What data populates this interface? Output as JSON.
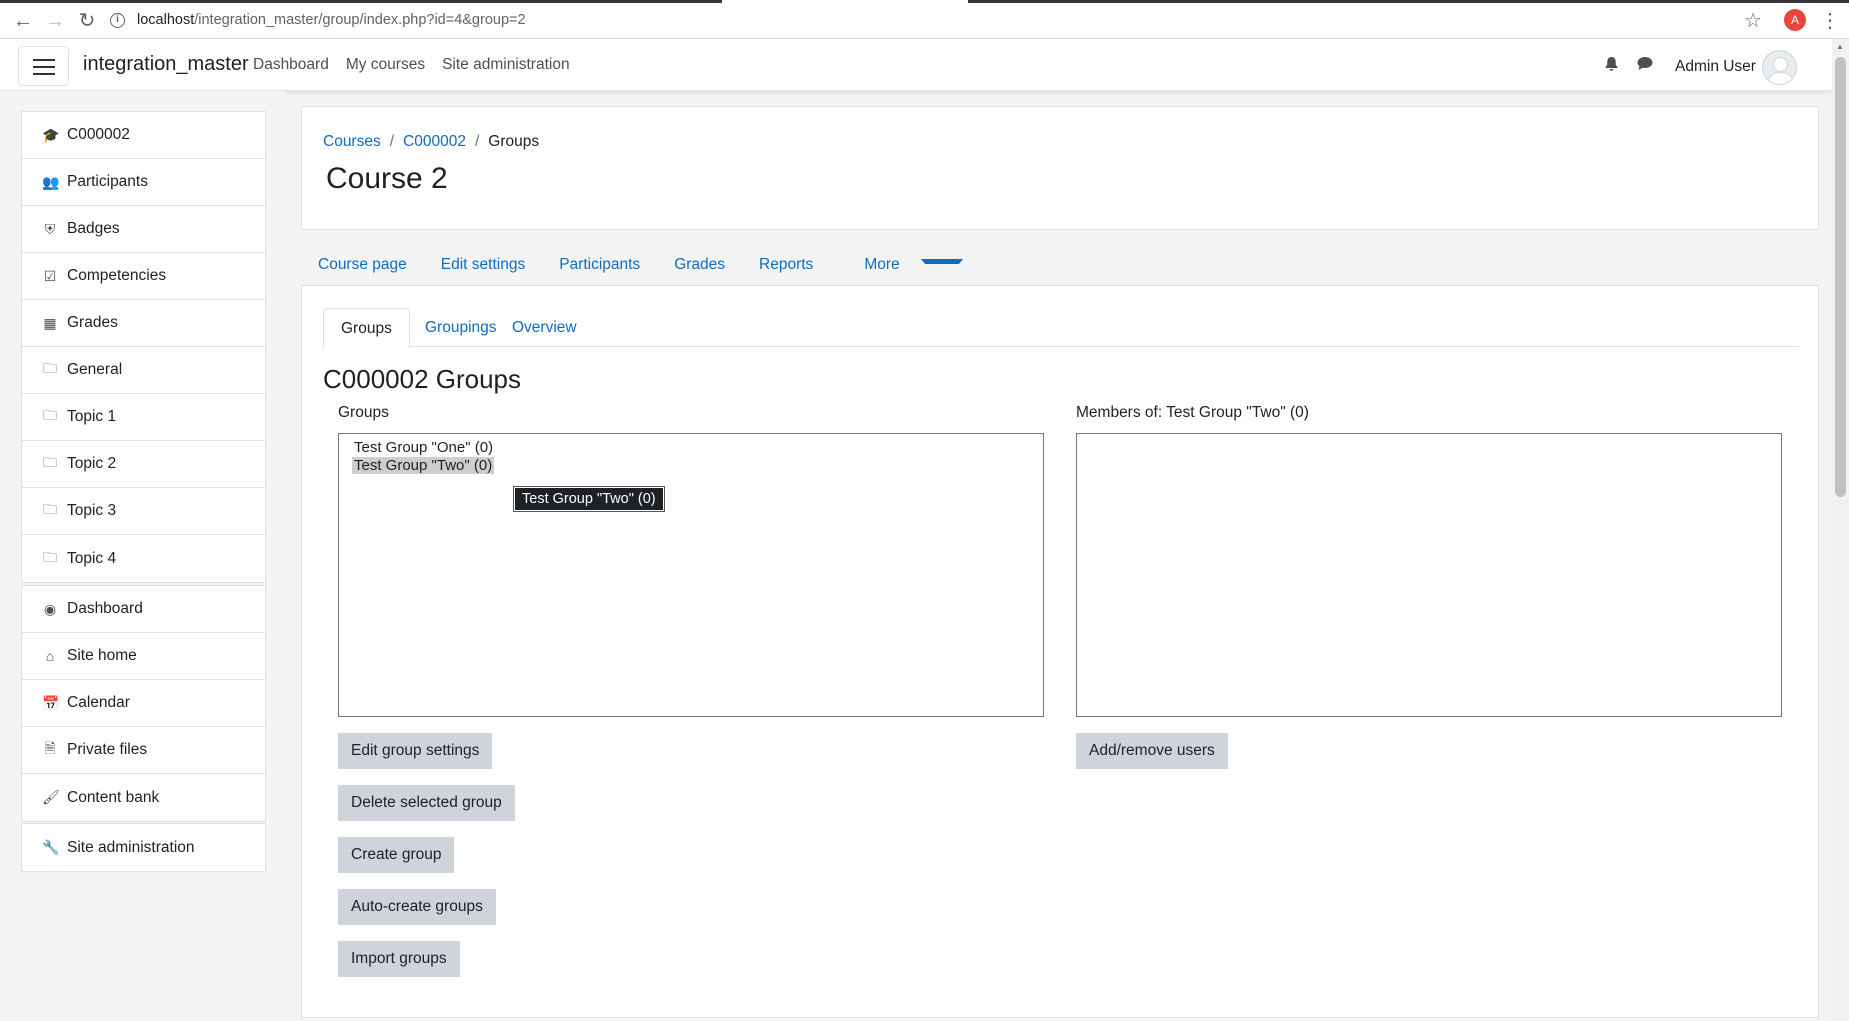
{
  "browser": {
    "url_host": "localhost",
    "url_path": "/integration_master/group/index.php?id=4&group=2",
    "profile_initial": "A"
  },
  "navbar": {
    "brand": "integration_master",
    "links": [
      "Dashboard",
      "My courses",
      "Site administration"
    ],
    "user_name": "Admin User"
  },
  "drawer": {
    "course_items": [
      {
        "label": "C000002",
        "icon": "graduation-cap-icon"
      },
      {
        "label": "Participants",
        "icon": "users-icon"
      },
      {
        "label": "Badges",
        "icon": "shield-icon"
      },
      {
        "label": "Competencies",
        "icon": "check-square-icon"
      },
      {
        "label": "Grades",
        "icon": "table-icon"
      },
      {
        "label": "General",
        "icon": "folder-icon"
      },
      {
        "label": "Topic 1",
        "icon": "folder-icon"
      },
      {
        "label": "Topic 2",
        "icon": "folder-icon"
      },
      {
        "label": "Topic 3",
        "icon": "folder-icon"
      },
      {
        "label": "Topic 4",
        "icon": "folder-icon"
      }
    ],
    "site_items": [
      {
        "label": "Dashboard",
        "icon": "tachometer-icon"
      },
      {
        "label": "Site home",
        "icon": "home-icon"
      },
      {
        "label": "Calendar",
        "icon": "calendar-icon"
      },
      {
        "label": "Private files",
        "icon": "file-icon"
      },
      {
        "label": "Content bank",
        "icon": "paint-brush-icon"
      }
    ],
    "admin_items": [
      {
        "label": "Site administration",
        "icon": "wrench-icon"
      }
    ]
  },
  "header": {
    "breadcrumb": [
      "Courses",
      "C000002",
      "Groups"
    ],
    "title": "Course 2"
  },
  "secondary_nav": [
    "Course page",
    "Edit settings",
    "Participants",
    "Grades",
    "Reports",
    "More"
  ],
  "tabs": [
    "Groups",
    "Groupings",
    "Overview"
  ],
  "page_heading": "C000002 Groups",
  "groups_panel": {
    "label": "Groups",
    "options": [
      "Test Group \"One\" (0)",
      "Test Group \"Two\" (0)"
    ],
    "selected_index": 1,
    "tooltip": "Test Group \"Two\" (0)",
    "buttons": [
      "Edit group settings",
      "Delete selected group",
      "Create group",
      "Auto-create groups",
      "Import groups"
    ]
  },
  "members_panel": {
    "label": "Members of: Test Group \"Two\" (0)",
    "button": "Add/remove users"
  }
}
